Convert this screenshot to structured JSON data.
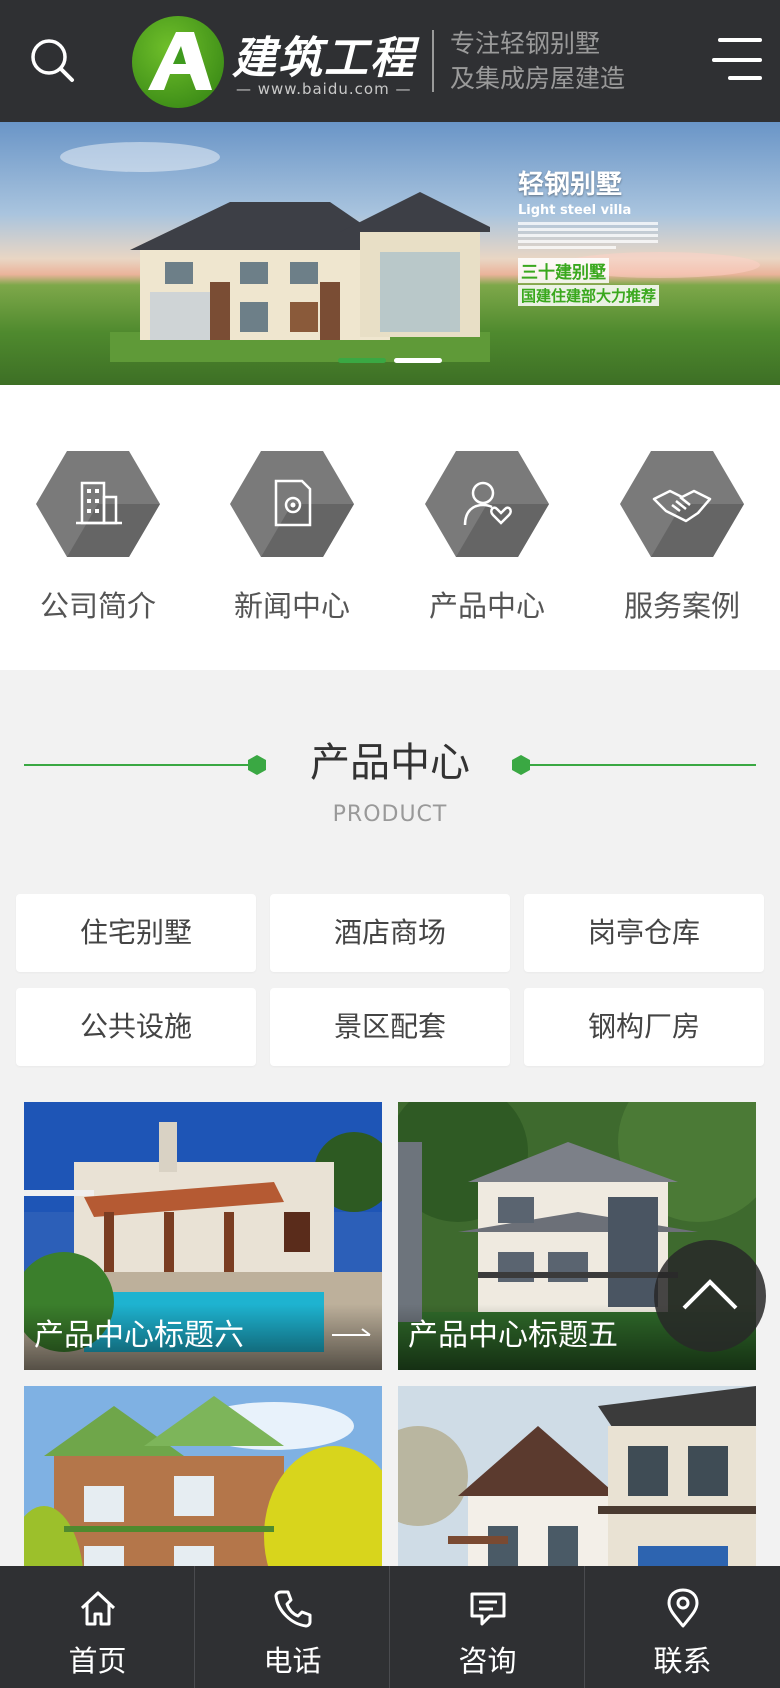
{
  "header": {
    "logo_letter": "A",
    "logo_title": "建筑工程",
    "logo_url": "— www.baidu.com —",
    "slogan_line1": "专注轻钢别墅",
    "slogan_line2": "及集成房屋建造",
    "search_icon": "search-icon",
    "menu_icon": "hamburger-menu-icon"
  },
  "banner": {
    "title": "轻钢别墅",
    "subtitle": "Light steel villa",
    "line1": "三十建别墅",
    "line2": "国建住建部大力推荐",
    "active_slide": 1,
    "slide_count": 2
  },
  "quick_nav": [
    {
      "label": "公司简介",
      "icon": "building-icon"
    },
    {
      "label": "新闻中心",
      "icon": "document-gear-icon"
    },
    {
      "label": "产品中心",
      "icon": "user-heart-icon"
    },
    {
      "label": "服务案例",
      "icon": "handshake-icon"
    }
  ],
  "product_section": {
    "title": "产品中心",
    "subtitle": "PRODUCT"
  },
  "categories": [
    "住宅别墅",
    "酒店商场",
    "岗亭仓库",
    "公共设施",
    "景区配套",
    "钢构厂房"
  ],
  "products": [
    {
      "title": "产品中心标题六"
    },
    {
      "title": "产品中心标题五"
    },
    {
      "title": ""
    },
    {
      "title": ""
    }
  ],
  "bottom_nav": [
    {
      "label": "首页",
      "icon": "home-icon"
    },
    {
      "label": "电话",
      "icon": "phone-icon"
    },
    {
      "label": "咨询",
      "icon": "chat-icon"
    },
    {
      "label": "联系",
      "icon": "location-pin-icon"
    }
  ],
  "colors": {
    "header_bg": "#2f3033",
    "accent_green": "#3aa843",
    "hex_gray": "#777777"
  }
}
